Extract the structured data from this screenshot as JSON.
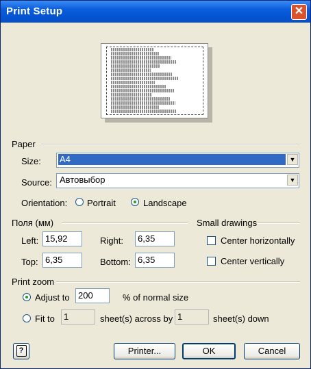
{
  "window": {
    "title": "Print Setup",
    "close_icon": "✕"
  },
  "preview": {
    "lines": [
      "Microsoft",
      "Microsoft",
      "Microsoft",
      "Microsoft",
      "Microsoft",
      "Microsoft",
      "Microsoft",
      "Microsoft",
      "Microsoft",
      "Microsoft",
      "Microsoft",
      "Microsoft",
      "Microsoft",
      "Microsoft",
      "Microsoft",
      "Microsoft"
    ]
  },
  "paper": {
    "group_label": "Paper",
    "size_label": "Size:",
    "size_value": "A4",
    "source_label": "Source:",
    "source_value": "Автовыбор",
    "orientation_label": "Orientation:",
    "portrait_label": "Portrait",
    "landscape_label": "Landscape",
    "orientation_selected": "Landscape"
  },
  "margins": {
    "group_label": "Поля (мм)",
    "left_label": "Left:",
    "left_value": "15,92",
    "right_label": "Right:",
    "right_value": "6,35",
    "top_label": "Top:",
    "top_value": "6,35",
    "bottom_label": "Bottom:",
    "bottom_value": "6,35"
  },
  "small_drawings": {
    "group_label": "Small drawings",
    "center_h_label": "Center horizontally",
    "center_v_label": "Center vertically"
  },
  "zoom": {
    "group_label": "Print zoom",
    "adjust_label": "Adjust to",
    "adjust_value": "200",
    "adjust_suffix": "% of normal size",
    "fit_label": "Fit to",
    "fit_across_value": "1",
    "fit_across_suffix": "sheet(s) across by",
    "fit_down_value": "1",
    "fit_down_suffix": "sheet(s) down",
    "selected": "adjust"
  },
  "buttons": {
    "help_glyph": "?",
    "printer_label": "Printer...",
    "ok_label": "OK",
    "cancel_label": "Cancel"
  },
  "colors": {
    "title_bar": "#0453d1",
    "selection": "#316ac5",
    "dialog_bg": "#ece9d8"
  }
}
